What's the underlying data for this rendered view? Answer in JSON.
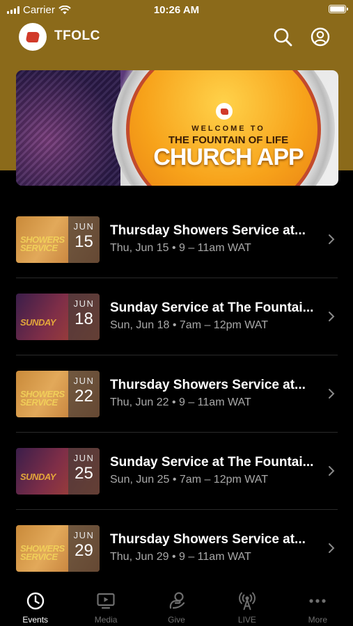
{
  "status_bar": {
    "carrier": "Carrier",
    "time": "10:26 AM"
  },
  "header": {
    "title": "TFOLC",
    "search_icon": "search-icon",
    "profile_icon": "account-icon"
  },
  "banner": {
    "line1": "WELCOME TO",
    "line2": "THE FOUNTAIN OF LIFE",
    "line3": "CHURCH APP"
  },
  "events": [
    {
      "thumb": "thursday",
      "thumb_text": "SHOWERS SERVICE",
      "month": "JUN",
      "day": "15",
      "title": "Thursday Showers Service at...",
      "subtitle": "Thu, Jun 15 • 9 – 11am WAT"
    },
    {
      "thumb": "sunday",
      "thumb_text": "SUNDAY",
      "month": "JUN",
      "day": "18",
      "title": "Sunday Service at The Fountai...",
      "subtitle": "Sun, Jun 18 • 7am – 12pm WAT"
    },
    {
      "thumb": "thursday",
      "thumb_text": "SHOWERS SERVICE",
      "month": "JUN",
      "day": "22",
      "title": "Thursday Showers Service at...",
      "subtitle": "Thu, Jun 22 • 9 – 11am WAT"
    },
    {
      "thumb": "sunday",
      "thumb_text": "SUNDAY",
      "month": "JUN",
      "day": "25",
      "title": "Sunday Service at The Fountai...",
      "subtitle": "Sun, Jun 25 • 7am – 12pm WAT"
    },
    {
      "thumb": "thursday",
      "thumb_text": "SHOWERS SERVICE",
      "month": "JUN",
      "day": "29",
      "title": "Thursday Showers Service at...",
      "subtitle": "Thu, Jun 29 • 9 – 11am WAT"
    }
  ],
  "tabs": [
    {
      "label": "Events",
      "icon": "clock-icon",
      "active": true
    },
    {
      "label": "Media",
      "icon": "tv-icon",
      "active": false
    },
    {
      "label": "Give",
      "icon": "give-icon",
      "active": false
    },
    {
      "label": "LIVE",
      "icon": "broadcast-icon",
      "active": false
    },
    {
      "label": "More",
      "icon": "more-icon",
      "active": false
    }
  ],
  "colors": {
    "header_band": "#8b6a1a",
    "background": "#000000",
    "tab_inactive": "#6f6f6f",
    "subtitle": "#a9a9a9"
  }
}
